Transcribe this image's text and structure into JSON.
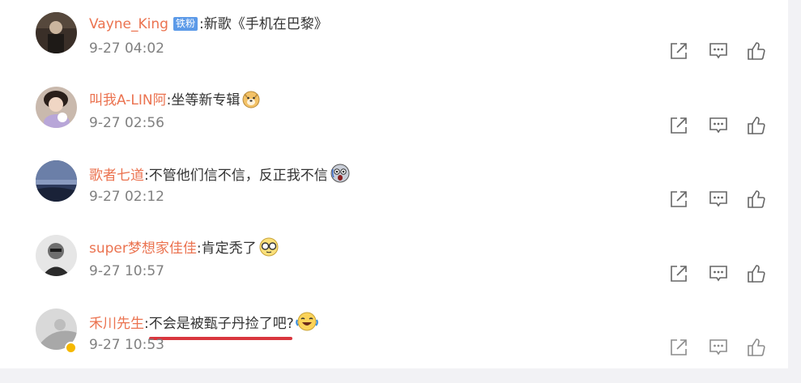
{
  "comments": [
    {
      "username": "Vayne_King",
      "badge": "铁粉",
      "text": ":新歌《手机在巴黎》",
      "time": "9-27 04:02"
    },
    {
      "username": "叫我A-LIN阿",
      "text": ":坐等新专辑",
      "emoji": "doge-emoji",
      "time": "9-27 02:56"
    },
    {
      "username": "歌者七道",
      "text": ":不管他们信不信，反正我不信",
      "emoji": "scared-emoji",
      "time": "9-27 02:12"
    },
    {
      "username": "super梦想家佳佳",
      "text": ":肯定秃了",
      "emoji": "glasses-emoji",
      "time": "9-27 10:57"
    },
    {
      "username": "禾川先生",
      "text": ":不会是被甄子丹捡了吧?",
      "emoji": "laugh-cry-emoji",
      "time": "9-27 10:53",
      "verified": true,
      "underlined_text": true
    }
  ],
  "actions": {
    "share_icon": "share-icon",
    "reply_icon": "comment-icon",
    "like_icon": "thumbs-up-icon"
  },
  "colors": {
    "username": "#eb7350",
    "time": "#808080",
    "badge_bg": "#5c9ae8",
    "underline": "#d9363e",
    "verified": "#f5b800"
  }
}
